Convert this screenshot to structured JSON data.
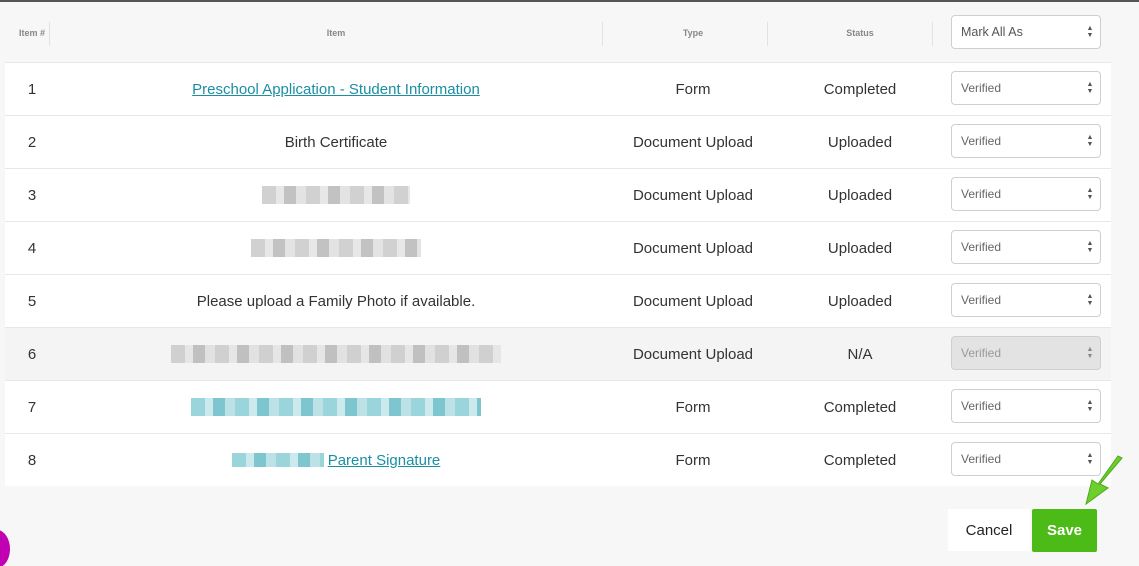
{
  "header": {
    "item_num": "Item #",
    "item": "Item",
    "type": "Type",
    "status": "Status",
    "mark_all": "Mark All As"
  },
  "rows": [
    {
      "num": "1",
      "item": "Preschool Application - Student Information",
      "type": "Form",
      "status": "Completed",
      "verification": "Verified"
    },
    {
      "num": "2",
      "item": "Birth Certificate",
      "type": "Document Upload",
      "status": "Uploaded",
      "verification": "Verified"
    },
    {
      "num": "3",
      "item": "",
      "type": "Document Upload",
      "status": "Uploaded",
      "verification": "Verified"
    },
    {
      "num": "4",
      "item": "",
      "type": "Document Upload",
      "status": "Uploaded",
      "verification": "Verified"
    },
    {
      "num": "5",
      "item": "Please upload a Family Photo if available.",
      "type": "Document Upload",
      "status": "Uploaded",
      "verification": "Verified"
    },
    {
      "num": "6",
      "item": "",
      "type": "Document Upload",
      "status": "N/A",
      "verification": "Verified"
    },
    {
      "num": "7",
      "item": "",
      "type": "Form",
      "status": "Completed",
      "verification": "Verified"
    },
    {
      "num": "8",
      "item": "Parent Signature",
      "type": "Form",
      "status": "Completed",
      "verification": "Verified"
    }
  ],
  "footer": {
    "cancel_label": "Cancel",
    "save_label": "Save"
  },
  "icons": {
    "select_arrows": "up-down-caret-icon",
    "annotation_arrow": "green-arrow-icon"
  },
  "colors": {
    "link": "#1a8fa3",
    "save_button": "#4cbb17",
    "annotation_arrow": "#6ccf2b",
    "magenta_marker": "#c100b4"
  }
}
